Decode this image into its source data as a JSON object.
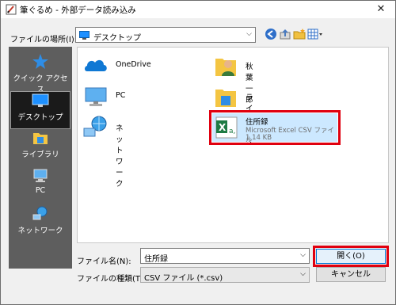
{
  "window": {
    "title": "筆ぐるめ - 外部データ読み込み",
    "close_glyph": "✕"
  },
  "lookin": {
    "label": "ファイルの場所(I):",
    "value": "デスクトップ",
    "arrow": "⌵"
  },
  "toolbar": {
    "icons": [
      "back-icon",
      "up-folder-icon",
      "new-folder-icon",
      "view-menu-icon"
    ]
  },
  "places": [
    {
      "label": "クイック アクセス",
      "icon": "quick-access-icon"
    },
    {
      "label": "デスクトップ",
      "icon": "desktop-icon",
      "selected": true
    },
    {
      "label": "ライブラリ",
      "icon": "library-icon"
    },
    {
      "label": "PC",
      "icon": "pc-icon"
    },
    {
      "label": "ネットワーク",
      "icon": "network-icon"
    }
  ],
  "files": {
    "onedrive": "OneDrive",
    "user": "秋葉一郎",
    "pc": "PC",
    "library": "ライブラリ",
    "network": "ネットワーク",
    "csv": {
      "name": "住所録",
      "type": "Microsoft Excel CSV ファイル",
      "size": "1.14 KB"
    }
  },
  "filename": {
    "label": "ファイル名(N):",
    "value": "住所録",
    "arrow": "⌵"
  },
  "filetype": {
    "label": "ファイルの種類(T):",
    "value": "CSV ファイル (*.csv)",
    "arrow": "⌵"
  },
  "buttons": {
    "open": "開く(O)",
    "cancel": "キャンセル"
  },
  "colors": {
    "highlight": "#e0000f",
    "accent": "#0078d7",
    "selection": "#cce8ff"
  }
}
